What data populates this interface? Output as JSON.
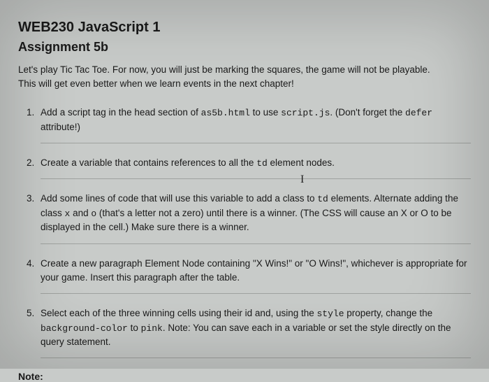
{
  "title": "WEB230 JavaScript 1",
  "subtitle": "Assignment 5b",
  "intro_line1": "Let's play Tic Tac Toe. For now, you will just be marking the squares, the game will not be playable.",
  "intro_line2": "This will get even better when we learn events in the next chapter!",
  "items": [
    {
      "num": "1.",
      "pre": "Add a script tag in the head section of ",
      "code1": "as5b.html",
      "mid1": " to use ",
      "code2": "script.js",
      "mid2": ". (Don't forget the ",
      "code3": "defer",
      "post": " attribute!)"
    },
    {
      "num": "2.",
      "pre": "Create a variable that contains references to all the ",
      "code1": "td",
      "post": " element nodes."
    },
    {
      "num": "3.",
      "pre": "Add some lines of code that will use this variable to add a class to ",
      "code1": "td",
      "mid1": " elements. Alternate adding the class ",
      "code2": "x",
      "mid2": " and ",
      "code3": "o",
      "post": " (that's a letter not a zero) until there is a winner. (The CSS will cause an X or O to be displayed in the cell.) Make sure there is a winner."
    },
    {
      "num": "4.",
      "text": "Create a new paragraph Element Node containing \"X Wins!\" or \"O Wins!\", whichever is appropriate for your game. Insert this paragraph after the table."
    },
    {
      "num": "5.",
      "pre": "Select each of the three winning cells using their id and, using the ",
      "code1": "style",
      "mid1": " property, change the ",
      "code2": "background-color",
      "mid2": " to ",
      "code3": "pink",
      "post": ". Note: You can save each in a variable or set the style directly on the query statement."
    }
  ],
  "note_label": "Note:"
}
